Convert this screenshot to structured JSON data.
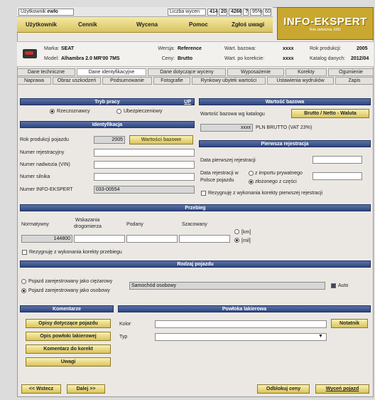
{
  "topbar": {
    "user_label": "Użytkownik",
    "user_value": "ewło",
    "quotes_label": "Liczba wycen",
    "q1": "414",
    "q2": "20",
    "q3": "4266",
    "q4": "?",
    "q5": "95%",
    "q6": "60"
  },
  "menu": {
    "user": "Użytkownik",
    "price": "Cennik",
    "valuation": "Wycena",
    "help": "Pomoc",
    "report": "Zgłoś uwagi"
  },
  "logo": {
    "title": "INFO-EKSPERT",
    "subtitle": "Rok założenia 1992"
  },
  "info": {
    "make_label": "Marka:",
    "make": "SEAT",
    "model_label": "Model:",
    "model": "Alhambra 2.0 MR'00 7MS",
    "version_label": "Wersja:",
    "version": "Reference",
    "prices_label": "Ceny:",
    "prices": "Brutto",
    "base_label": "Wart. bazowa:",
    "base": "xxxx",
    "corr_label": "Wart. po korekcie:",
    "corr": "xxxx",
    "year_label": "Rok produkcji:",
    "year": "2005",
    "catalog_label": "Katalog danych:",
    "catalog": "2012/04"
  },
  "tabs_row1": [
    "Dane techniczne",
    "Dane identyfikacyjne",
    "Dane dotyczące wyceny",
    "Wyposażenie",
    "Korekty",
    "Ogumienie"
  ],
  "tabs_row2": [
    "Naprawa",
    "Obraz uszkodzeń",
    "Podsumowanie",
    "Fotografie",
    "Rynkowy ubytek wartości",
    "Ustawienia wydruków",
    "Zapis"
  ],
  "mode": {
    "title": "Tryb pracy",
    "up": "UP",
    "opt1": "Rzeczoznawcy",
    "opt2": "Ubezpieczeniowy"
  },
  "ident": {
    "title": "Identyfikacja",
    "year_label": "Rok produkcji pojazdu",
    "year": "2005",
    "base_btn": "Wartości bazowe",
    "reg_label": "Numer rejestracyjny",
    "vin_label": "Numer nadwozia (VIN)",
    "engine_label": "Numer silnika",
    "ie_label": "Numer INFO-EKSPERT",
    "ie_value": "033-00554"
  },
  "base_value": {
    "title": "Wartość bazowa",
    "label": "Wartość bazowa wg katalogu",
    "btn": "Brutto / Netto - Waluta",
    "value": "xxxx",
    "currency": "PLN BRUTTO  (VAT 23%)"
  },
  "first_reg": {
    "title": "Pierwsza rejestracja",
    "date_label": "Data pierwszej rejestracji",
    "poland_label1": "Data rejestracji w",
    "poland_label2": "Polsce pojazdu",
    "opt1": "z importu prywatnego",
    "opt2": "złożonego z części",
    "resign": "Rezygnuję z wykonania korekty pierwszej rejestracji"
  },
  "mileage": {
    "title": "Przebieg",
    "c1": "Normatywny",
    "c2a": "Wskazania",
    "c2b": "drogomierza",
    "c3": "Podany",
    "c4": "Szacowany",
    "normative": "144800",
    "km": "[km]",
    "mil": "[mil]",
    "resign": "Rezygnuję z wykonania korekty przebiegu"
  },
  "vehicle": {
    "title": "Rodzaj pojazdu",
    "opt1": "Pojazd zarejestrowany jako ciężarowy",
    "opt2": "Pojazd zarejestrowany jako osobowy",
    "type": "Samochód osobowy",
    "auto": "Auto"
  },
  "comments": {
    "title": "Komentarze",
    "b1": "Opisy dotyczące pojazdu",
    "b2": "Opis powłoki lakierowej",
    "b3": "Komentarz do korekt",
    "b4": "Uwagi"
  },
  "paint": {
    "title": "Powłoka lakierowa",
    "color_label": "Kolor",
    "type_label": "Typ",
    "notes_btn": "Notatnik"
  },
  "footer": {
    "back": "<< Wstecz",
    "next": "Dalej >>",
    "unlock": "Odblokuj ceny",
    "save": "Wyceń pojazd"
  }
}
